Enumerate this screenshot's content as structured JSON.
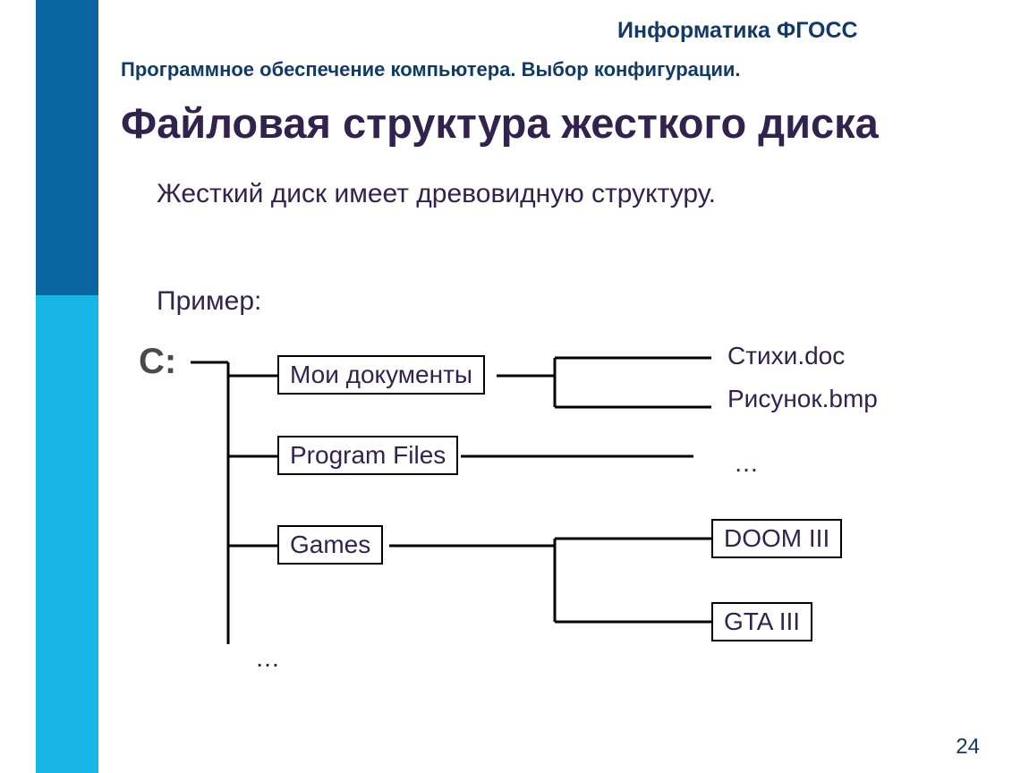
{
  "header_right": "Информатика ФГОСС",
  "subtitle": "Программное обеспечение компьютера. Выбор конфигурации.",
  "title": "Файловая структура жесткого диска",
  "body_text": "Жесткий диск имеет древовидную структуру.",
  "example_label": "Пример:",
  "page_number": "24",
  "tree": {
    "drive": "C:",
    "folders": {
      "docs": "Мои документы",
      "prog": "Program Files",
      "games": "Games"
    },
    "files_docs": {
      "f1": "Стихи.doc",
      "f2": "Рисунок.bmp"
    },
    "prog_more": "…",
    "games_children": {
      "g1": "DOOM III",
      "g2": "GTA III"
    },
    "root_more": "…"
  }
}
